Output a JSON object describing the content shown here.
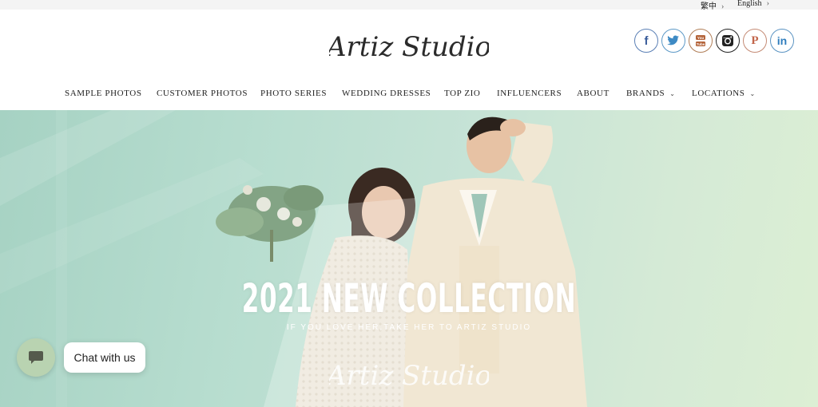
{
  "topbar": {
    "lang_zh": "繁中",
    "lang_en": "English",
    "arrow": "›"
  },
  "logo": {
    "text": "Artiz Studio",
    "color": "#2b2b2b"
  },
  "social": [
    {
      "icon": "facebook-icon",
      "glyph": "f"
    },
    {
      "icon": "twitter-icon",
      "glyph": "t"
    },
    {
      "icon": "youtube-icon",
      "glyph": "▶"
    },
    {
      "icon": "instagram-icon",
      "glyph": "◎"
    },
    {
      "icon": "pinterest-icon",
      "glyph": "P"
    },
    {
      "icon": "linkedin-icon",
      "glyph": "in"
    }
  ],
  "nav": {
    "sample_photos": "SAMPLE PHOTOS",
    "customer_photos": "CUSTOMER PHOTOS",
    "photo_series": "PHOTO SERIES",
    "wedding_dresses": "WEDDING DRESSES",
    "top_zio": "TOP ZIO",
    "influencers": "INFLUENCERS",
    "about": "ABOUT",
    "brands": "BRANDS",
    "locations": "LOCATIONS",
    "caret": "⌄"
  },
  "hero": {
    "title": "2021 NEW COLLECTION",
    "subtitle": "IF YOU LOVE HER,TAKE HER TO ARTIZ STUDIO",
    "watermark": "Artiz Studio"
  },
  "chat": {
    "label": "Chat with us",
    "icon": "chat-bubble-icon",
    "color": "#b9d3b1"
  }
}
